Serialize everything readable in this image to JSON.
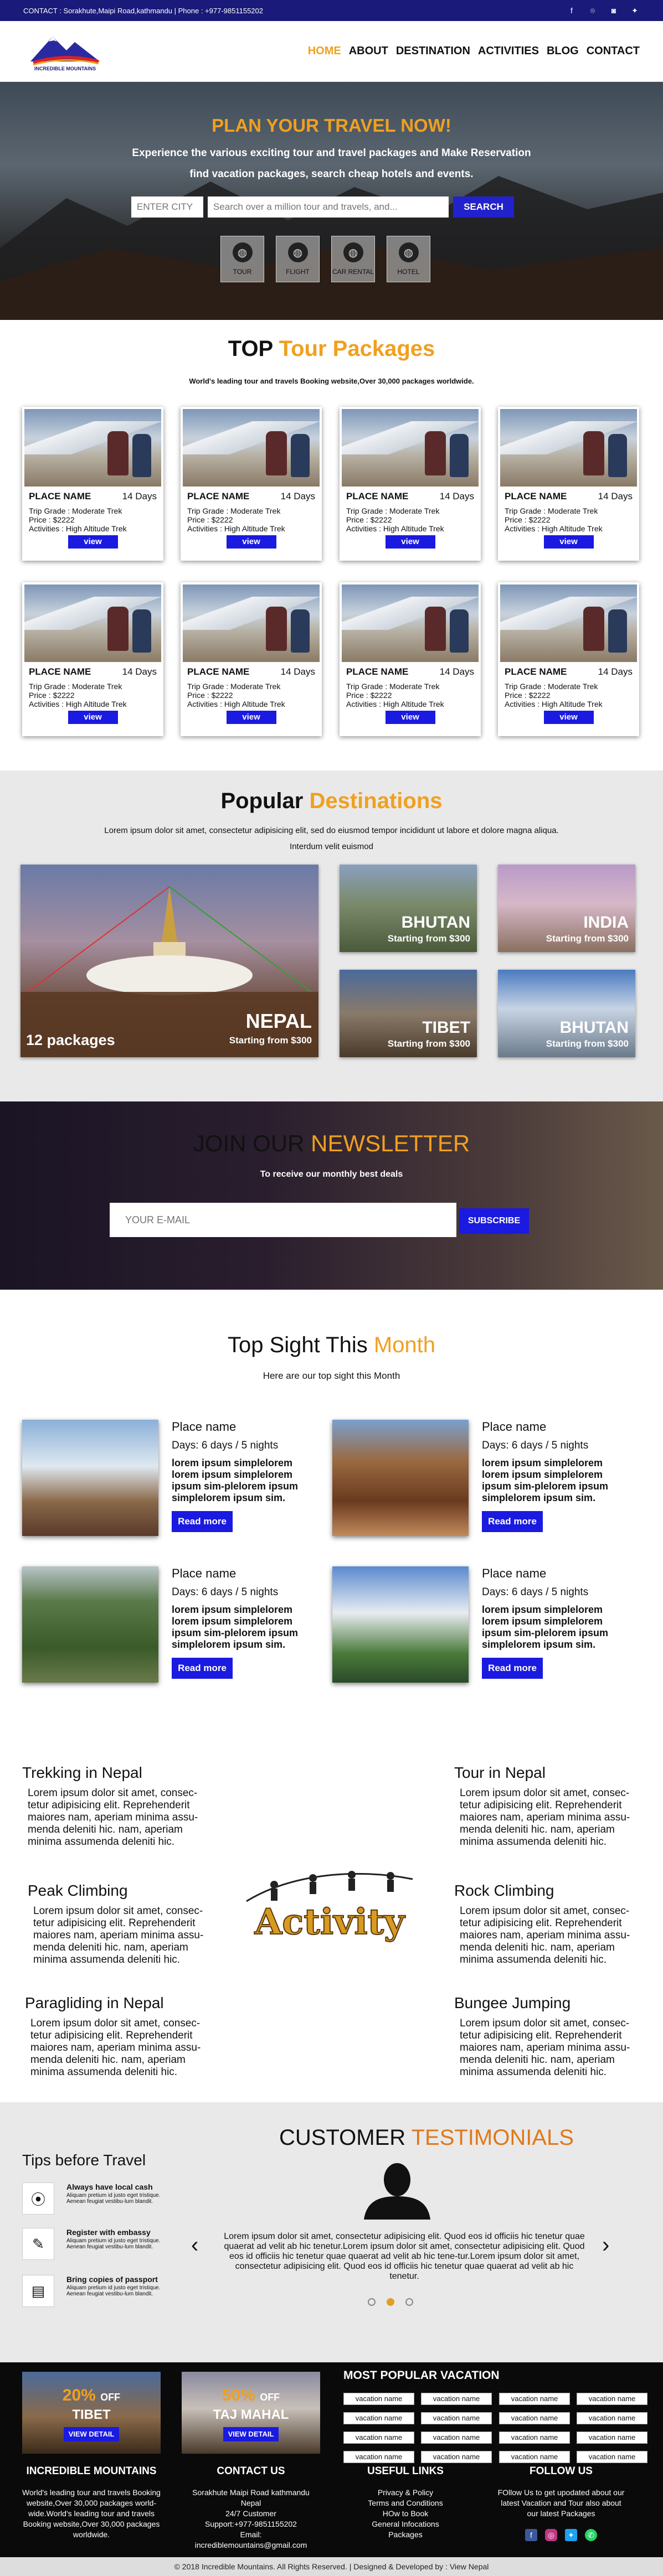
{
  "topbar": {
    "contact": "CONTACT : Sorakhute,Maipi Road,kathmandu | Phone : +977-9851155202",
    "social": [
      "facebook-icon",
      "github-icon",
      "instagram-icon",
      "twitter-icon"
    ]
  },
  "header": {
    "logo_text": "INCREDIBLE MOUNTAINS",
    "nav": [
      "HOME",
      "ABOUT",
      "DESTINATION",
      "ACTIVITIES",
      "BLOG",
      "CONTACT"
    ]
  },
  "hero": {
    "title": "PLAN YOUR TRAVEL NOW!",
    "line1": "Experience the various exciting tour and travel packages and Make Reservation",
    "line2": "find vacation packages, search cheap hotels and events.",
    "city_placeholder": "ENTER CITY",
    "search_placeholder": "Search over a million tour and travels, and...",
    "search_button": "SEARCH",
    "categories": [
      "TOUR",
      "FLIGHT",
      "CAR RENTAL",
      "HOTEL"
    ]
  },
  "packages": {
    "title_a": "TOP",
    "title_b": "Tour Packages",
    "subtitle": "World's leading tour and travels Booking website,Over 30,000 packages worldwide.",
    "items": [
      {
        "name": "PLACE NAME",
        "days": "14 Days",
        "grade": "Trip Grade : Moderate Trek",
        "price": "Price : $2222",
        "activities": "Activities : High Altitude Trek",
        "button": "view"
      },
      {
        "name": "PLACE NAME",
        "days": "14 Days",
        "grade": "Trip Grade : Moderate Trek",
        "price": "Price : $2222",
        "activities": "Activities : High Altitude Trek",
        "button": "view"
      },
      {
        "name": "PLACE NAME",
        "days": "14 Days",
        "grade": "Trip Grade : Moderate Trek",
        "price": "Price : $2222",
        "activities": "Activities : High Altitude Trek",
        "button": "view"
      },
      {
        "name": "PLACE NAME",
        "days": "14 Days",
        "grade": "Trip Grade : Moderate Trek",
        "price": "Price : $2222",
        "activities": "Activities : High Altitude Trek",
        "button": "view"
      },
      {
        "name": "PLACE NAME",
        "days": "14 Days",
        "grade": "Trip Grade : Moderate Trek",
        "price": "Price : $2222",
        "activities": "Activities : High Altitude Trek",
        "button": "view"
      },
      {
        "name": "PLACE NAME",
        "days": "14 Days",
        "grade": "Trip Grade : Moderate Trek",
        "price": "Price : $2222",
        "activities": "Activities : High Altitude Trek",
        "button": "view"
      },
      {
        "name": "PLACE NAME",
        "days": "14 Days",
        "grade": "Trip Grade : Moderate Trek",
        "price": "Price : $2222",
        "activities": "Activities : High Altitude Trek",
        "button": "view"
      },
      {
        "name": "PLACE NAME",
        "days": "14 Days",
        "grade": "Trip Grade : Moderate Trek",
        "price": "Price : $2222",
        "activities": "Activities : High Altitude Trek",
        "button": "view"
      }
    ]
  },
  "destinations": {
    "title_a": "Popular",
    "title_b": "Destinations",
    "line1": "Lorem ipsum dolor sit amet, consectetur adipisicing elit, sed do eiusmod tempor incididunt ut labore et dolore magna aliqua.",
    "line2": "Interdum velit euismod",
    "main": {
      "name": "NEPAL",
      "starting": "Starting from $300",
      "packages": "12 packages"
    },
    "small": [
      {
        "name": "BHUTAN",
        "starting": "Starting from $300"
      },
      {
        "name": "INDIA",
        "starting": "Starting from $300"
      },
      {
        "name": "TIBET",
        "starting": "Starting from $300"
      },
      {
        "name": "BHUTAN",
        "starting": "Starting from $300"
      }
    ]
  },
  "newsletter": {
    "title_a": "JOIN OUR",
    "title_b": "NEWSLETTER",
    "subtitle": "To receive our monthly best deals",
    "placeholder": "YOUR E-MAIL",
    "button": "SUBSCRIBE"
  },
  "sights": {
    "title_a": "Top Sight This",
    "title_b": "Month",
    "subtitle": "Here are our top sight this Month",
    "items": [
      {
        "name": "Place name",
        "days": "Days: 6 days / 5 nights",
        "desc": "lorem ipsum simplelorem lorem ipsum simplelorem ipsum sim-plelorem ipsum simplelorem ipsum sim.",
        "button": "Read more"
      },
      {
        "name": "Place name",
        "days": "Days: 6 days / 5 nights",
        "desc": "lorem ipsum simplelorem lorem ipsum simplelorem ipsum sim-plelorem ipsum simplelorem ipsum sim.",
        "button": "Read more"
      },
      {
        "name": "Place name",
        "days": "Days: 6 days / 5 nights",
        "desc": "lorem ipsum simplelorem lorem ipsum simplelorem ipsum sim-plelorem ipsum simplelorem ipsum sim.",
        "button": "Read more"
      },
      {
        "name": "Place name",
        "days": "Days: 6 days / 5 nights",
        "desc": "lorem ipsum simplelorem lorem ipsum simplelorem ipsum sim-plelorem ipsum simplelorem ipsum sim.",
        "button": "Read more"
      }
    ]
  },
  "activities": {
    "center_label": "Activity",
    "items": [
      {
        "title": "Trekking in Nepal",
        "desc": "Lorem ipsum dolor sit amet, consec-tetur adipisicing elit. Reprehenderit maiores nam, aperiam minima assu-menda deleniti hic.  nam, aperiam minima assumenda deleniti hic."
      },
      {
        "title": "Tour in Nepal",
        "desc": "Lorem ipsum dolor sit amet, consec-tetur adipisicing elit. Reprehenderit maiores nam, aperiam minima assu-menda deleniti hic.  nam, aperiam minima assumenda deleniti hic."
      },
      {
        "title": "Peak Climbing",
        "desc": "Lorem ipsum dolor sit amet, consec-tetur adipisicing elit. Reprehenderit maiores nam, aperiam minima assu-menda deleniti hic.  nam, aperiam minima assumenda deleniti hic."
      },
      {
        "title": "Rock Climbing",
        "desc": "Lorem ipsum dolor sit amet, consec-tetur adipisicing elit. Reprehenderit maiores nam, aperiam minima assu-menda deleniti hic.  nam, aperiam minima assumenda deleniti hic."
      },
      {
        "title": "Paragliding in Nepal",
        "desc": "Lorem ipsum dolor sit amet, consec-tetur adipisicing elit. Reprehenderit maiores nam, aperiam minima assu-menda deleniti hic.  nam, aperiam minima assumenda deleniti hic."
      },
      {
        "title": "Bungee Jumping",
        "desc": "Lorem ipsum dolor sit amet, consec-tetur adipisicing elit. Reprehenderit maiores nam, aperiam minima assu-menda deleniti hic.  nam, aperiam minima assumenda deleniti hic."
      }
    ]
  },
  "tips": {
    "title": "Tips before Travel",
    "items": [
      {
        "title": "Always have local cash",
        "desc": "Aliquam pretium id justo eget tristique. Aenean feugiat vestibu-lum blandit."
      },
      {
        "title": "Register with embassy",
        "desc": "Aliquam pretium id justo eget tristique. Aenean feugiat vestibu-lum blandit."
      },
      {
        "title": "Bring copies of passport",
        "desc": "Aliquam pretium id justo eget tristique. Aenean feugiat vestibu-lum blandit."
      }
    ]
  },
  "testimonials": {
    "title_a": "CUSTOMER",
    "title_b": "TESTIMONIALS",
    "text": "Lorem ipsum dolor sit amet, consectetur adipisicing elit. Quod eos id officiis hic tenetur quae quaerat ad velit ab hic tenetur.Lorem ipsum dolor sit amet, consectetur adipisicing elit. Quod eos id officiis hic tenetur quae quaerat ad velit ab hic tene-tur.Lorem ipsum dolor sit amet, consectetur adipisicing elit. Quod eos id officiis hic tenetur quae quaerat ad velit ab hic tenetur."
  },
  "offers": [
    {
      "percent": "20%",
      "off": "OFF",
      "place": "TIBET",
      "button": "VIEW DETAIL"
    },
    {
      "percent": "50%",
      "off": "OFF",
      "place": "TAJ MAHAL",
      "button": "VIEW DETAIL"
    }
  ],
  "popular_vacation": {
    "title": "MOST POPULAR VACATION",
    "items": [
      "vacation name",
      "vacation name",
      "vacation name",
      "vacation name",
      "vacation name",
      "vacation name",
      "vacation name",
      "vacation name",
      "vacation name",
      "vacation name",
      "vacation name",
      "vacation name",
      "vacation name",
      "vacation name",
      "vacation name",
      "vacation name"
    ]
  },
  "footer": {
    "about_title": "INCREDIBLE MOUNTAINS",
    "about_text": "World's leading tour and travels Booking website,Over 30,000 packages world-wide.World's leading tour and travels Booking website,Over 30,000 packages worldwide.",
    "contact_title": "CONTACT US",
    "contact_lines": [
      "Sorakhute Maipi Road kathmandu",
      "Nepal",
      "24/7 Customer",
      "Support:+977-9851155202",
      "Email: incrediblemountains@gmail.com"
    ],
    "links_title": "USEFUL LINKS",
    "links": [
      "Privacy & Policy",
      "Terms and Conditions",
      "HOw to Book",
      "General Infocations",
      "Packages"
    ],
    "follow_title": "FOLLOW US",
    "follow_text": "FOllow Us  to get upodated  about our latest Vacation and Tour also about our latest Packages",
    "copyright": "© 2018 Incredible Mountains. All Rights Reserved. | Designed & Developed by : View Nepal"
  },
  "colors": {
    "accent": "#f0a020",
    "brand_blue": "#1a1a7a",
    "button_blue": "#1a1ae0"
  }
}
